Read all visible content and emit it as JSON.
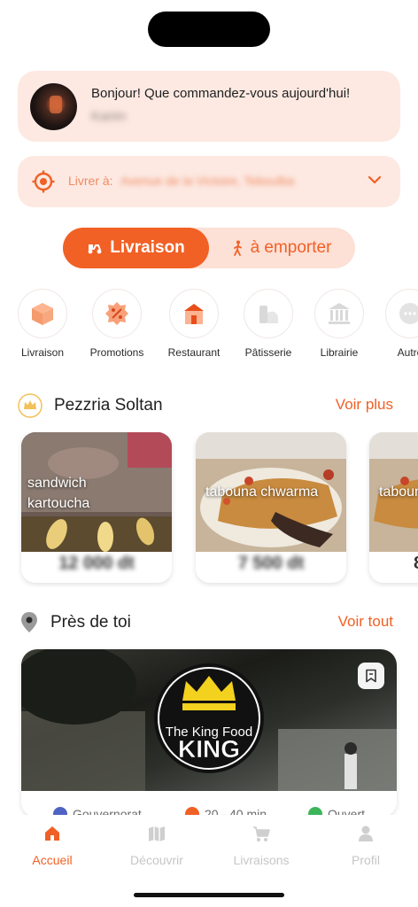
{
  "greeting": {
    "message": "Bonjour! Que commandez-vous aujourd'hui!",
    "name": "Karim"
  },
  "delivery_address": {
    "label": "Livrer à:",
    "value": "Avenue de la Victoire, Teboulba"
  },
  "mode_toggle": {
    "active_label": "Livraison",
    "inactive_label": "à emporter"
  },
  "categories": [
    {
      "label": "Livraison",
      "icon": "package-icon"
    },
    {
      "label": "Promotions",
      "icon": "discount-icon"
    },
    {
      "label": "Restaurant",
      "icon": "restaurant-icon"
    },
    {
      "label": "Pâtisserie",
      "icon": "pastry-icon"
    },
    {
      "label": "Librairie",
      "icon": "library-icon"
    },
    {
      "label": "Autre",
      "icon": "more-icon"
    }
  ],
  "featured": {
    "title": "Pezzria Soltan",
    "link": "Voir plus",
    "products": [
      {
        "name": "sandwich kartoucha",
        "price": "12 000 dt"
      },
      {
        "name": "tabouna chwarma",
        "price": "7 500 dt"
      },
      {
        "name": "tabouna chwarma",
        "price": "8"
      }
    ]
  },
  "nearby": {
    "title": "Près de toi",
    "link": "Voir tout",
    "restaurant": {
      "logo_text": "The King Food",
      "logo_subtext": "KING",
      "location": "Gouvernorat",
      "time": "20 - 40 min",
      "status": "Ouvert"
    }
  },
  "tabbar": [
    {
      "label": "Accueil",
      "icon": "home-icon",
      "active": true
    },
    {
      "label": "Découvrir",
      "icon": "map-icon",
      "active": false
    },
    {
      "label": "Livraisons",
      "icon": "cart-icon",
      "active": false
    },
    {
      "label": "Profil",
      "icon": "user-icon",
      "active": false
    }
  ],
  "colors": {
    "accent": "#f16025",
    "accent_light": "#fde9e2",
    "tab_inactive": "#c6c6c6"
  }
}
